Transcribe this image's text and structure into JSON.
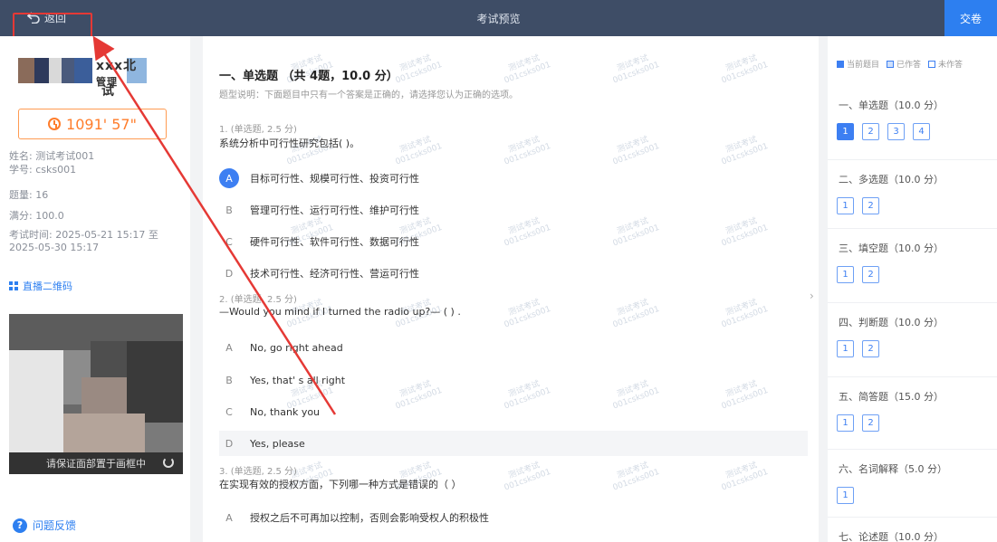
{
  "topbar": {
    "back_label": "返回",
    "title": "考试预览",
    "submit_label": "交卷"
  },
  "left": {
    "school_name": "xxx北",
    "school_name_line2": "管理",
    "school_name_suffix": "试",
    "timer": "1091' 57\"",
    "name": "姓名: 测试考试001",
    "student_id": "学号: csks001",
    "question_count": "题量: 16",
    "full_score": "满分: 100.0",
    "exam_time_line1": "考试时间: 2025-05-21 15:17 至",
    "exam_time_line2": "2025-05-30 15:17",
    "qr_label": "直播二维码",
    "camera_hint": "请保证面部置于画框中",
    "feedback_label": "问题反馈"
  },
  "main": {
    "watermark_line1": "测试考试",
    "watermark_line2": "001csks001",
    "section_title": "一、单选题 （共 4题，10.0 分）",
    "section_desc": "题型说明：下面题目中只有一个答案是正确的，请选择您认为正确的选项。",
    "questions": [
      {
        "meta": "1. (单选题, 2.5 分)",
        "text": "系统分析中可行性研究包括(      )。",
        "options": [
          {
            "letter": "A",
            "text": "目标可行性、规模可行性、投资可行性"
          },
          {
            "letter": "B",
            "text": "管理可行性、运行可行性、维护可行性"
          },
          {
            "letter": "C",
            "text": "硬件可行性、软件可行性、数据可行性"
          },
          {
            "letter": "D",
            "text": "技术可行性、经济可行性、营运可行性"
          }
        ]
      },
      {
        "meta": "2. (单选题, 2.5 分)",
        "text": "—Would you mind if I turned the radio up?— ( ) .",
        "options": [
          {
            "letter": "A",
            "text": "No, go right ahead"
          },
          {
            "letter": "B",
            "text": "Yes, that' s all right"
          },
          {
            "letter": "C",
            "text": "No, thank you"
          },
          {
            "letter": "D",
            "text": "Yes, please"
          }
        ]
      },
      {
        "meta": "3. (单选题, 2.5 分)",
        "text": "在实现有效的授权方面，下列哪一种方式是错误的（      ）",
        "options": [
          {
            "letter": "A",
            "text": "授权之后不可再加以控制，否则会影响受权人的积极性"
          }
        ]
      }
    ]
  },
  "right": {
    "legend": {
      "current": "当前题目",
      "done": "已作答",
      "undone": "未作答"
    },
    "categories": [
      {
        "label": "一、单选题（10.0 分）",
        "items": [
          "1",
          "2",
          "3",
          "4"
        ]
      },
      {
        "label": "二、多选题（10.0 分）",
        "items": [
          "1",
          "2"
        ]
      },
      {
        "label": "三、填空题（10.0 分）",
        "items": [
          "1",
          "2"
        ]
      },
      {
        "label": "四、判断题（10.0 分）",
        "items": [
          "1",
          "2"
        ]
      },
      {
        "label": "五、简答题（15.0 分）",
        "items": [
          "1",
          "2"
        ]
      },
      {
        "label": "六、名词解释（5.0 分）",
        "items": [
          "1"
        ]
      },
      {
        "label": "七、论述题（10.0 分）",
        "items": []
      }
    ]
  },
  "colors": {
    "topbar": "#3e4d66",
    "accent": "#2d7ff0",
    "timer": "#ff7d2b",
    "annotation": "#e53935"
  }
}
